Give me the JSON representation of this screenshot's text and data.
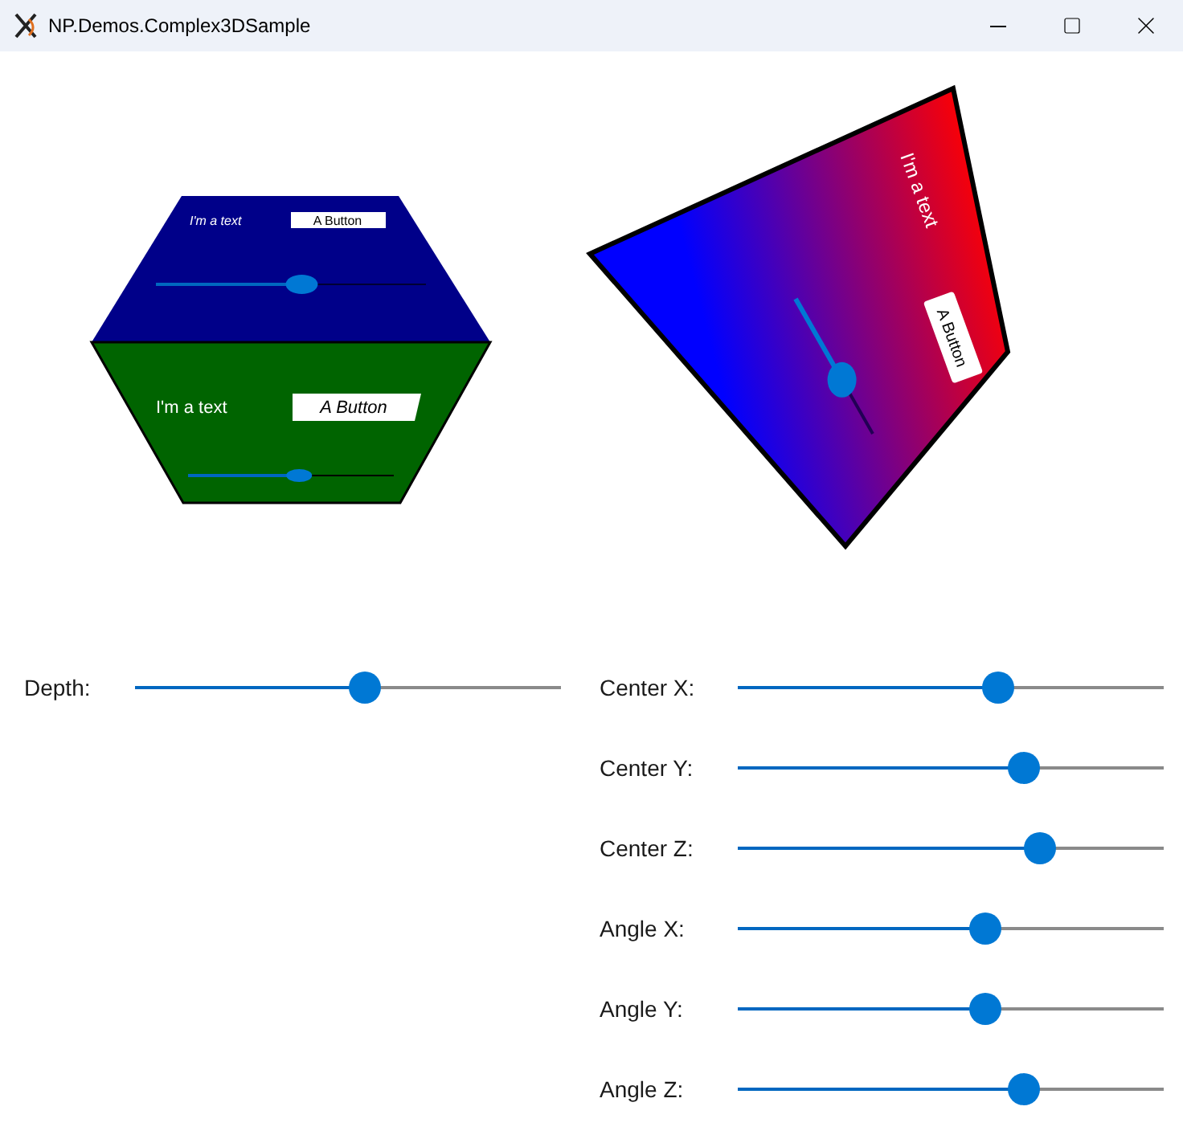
{
  "window": {
    "title": "NP.Demos.Complex3DSample"
  },
  "cube": {
    "faces": [
      {
        "kind": "top",
        "color": "#000089",
        "text": "I'm a text",
        "button": "A Button",
        "level": 0.54
      },
      {
        "kind": "front",
        "color": "#006400",
        "text": "I'm a text",
        "button": "A Button",
        "level": 0.54
      }
    ]
  },
  "plane": {
    "text": "I'm a text",
    "button": "A Button",
    "level": 0.6
  },
  "depth": {
    "label": "Depth:",
    "level": 0.54
  },
  "controls": [
    {
      "label": "Center X:",
      "level": 0.61
    },
    {
      "label": "Center Y:",
      "level": 0.67
    },
    {
      "label": "Center Z:",
      "level": 0.71
    },
    {
      "label": "Angle X:",
      "level": 0.58
    },
    {
      "label": "Angle Y:",
      "level": 0.58
    },
    {
      "label": "Angle Z:",
      "level": 0.67
    }
  ]
}
